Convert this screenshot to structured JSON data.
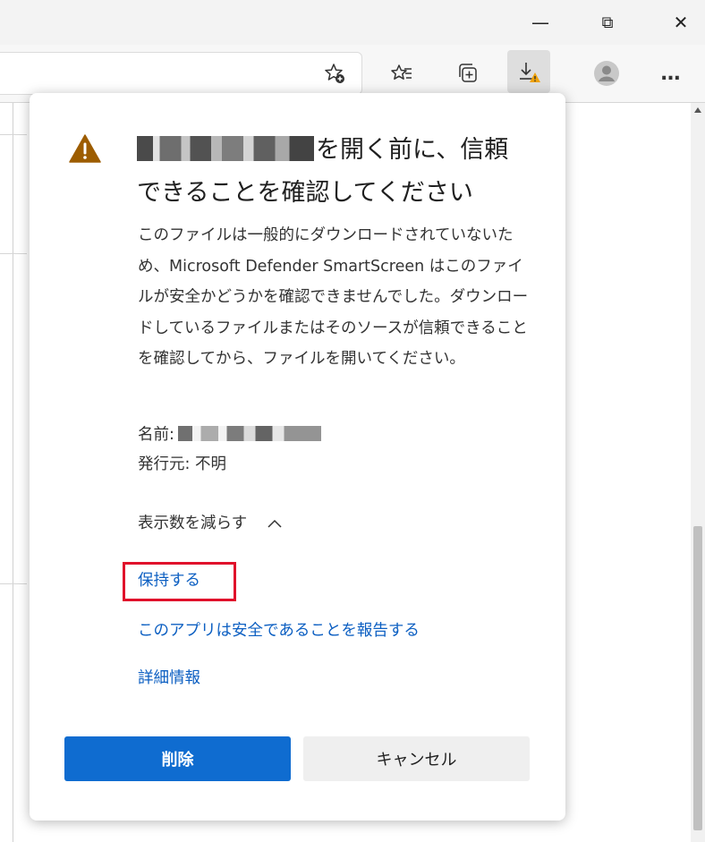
{
  "window": {
    "minimize_glyph": "—",
    "maximize_glyph": "⧉",
    "close_glyph": "✕"
  },
  "toolbar": {
    "icons": [
      "add-favorite-icon",
      "favorites-icon",
      "collections-icon",
      "downloads-icon",
      "profile-icon",
      "more-icon"
    ],
    "more_glyph": "…"
  },
  "dialog": {
    "heading_rest": "を開く前に、信頼できることを確認してください",
    "description": "このファイルは一般的にダウンロードされていないため、Microsoft Defender SmartScreen はこのファイルが安全かどうかを確認できませんでした。ダウンロードしているファイルまたはそのソースが信頼できることを確認してから、ファイルを開いてください。",
    "name_label": "名前:",
    "publisher_label": "発行元:",
    "publisher_value": "不明",
    "show_less_label": "表示数を減らす",
    "keep_link": "保持する",
    "report_link": "このアプリは安全であることを報告する",
    "more_info_link": "詳細情報",
    "delete_button": "削除",
    "cancel_button": "キャンセル"
  },
  "colors": {
    "accent": "#0f6cd0",
    "link": "#0c5fc2",
    "warning": "#9d5d00",
    "highlight_box": "#e0112b"
  }
}
